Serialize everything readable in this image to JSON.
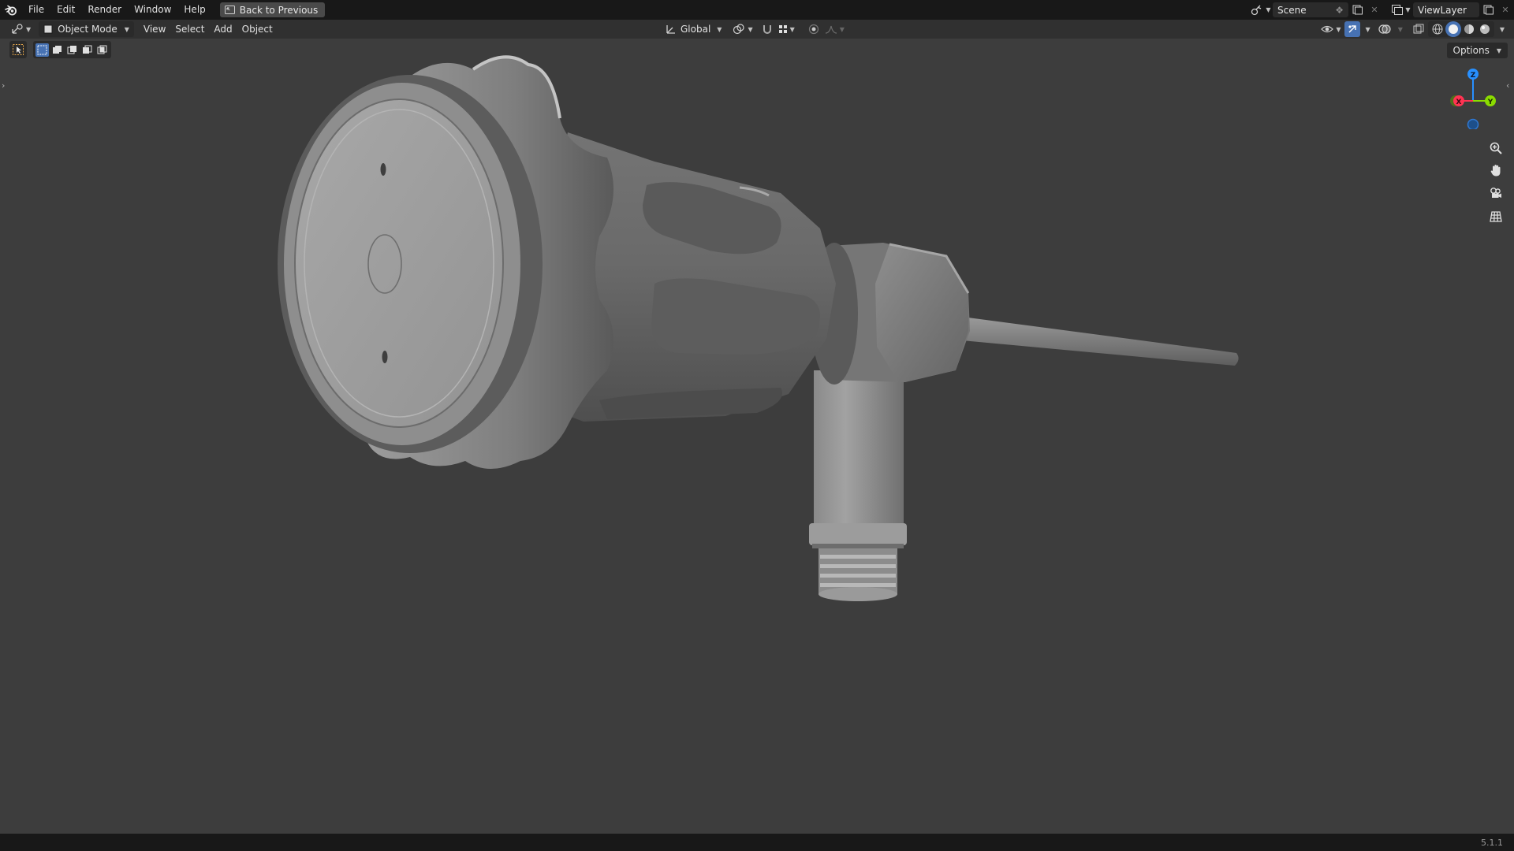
{
  "app": {
    "menus": [
      {
        "label": "File"
      },
      {
        "label": "Edit"
      },
      {
        "label": "Render"
      },
      {
        "label": "Window"
      },
      {
        "label": "Help"
      }
    ],
    "back_button": "Back to Previous",
    "scene_name": "Scene",
    "view_layer": "ViewLayer"
  },
  "viewport_header": {
    "mode": "Object Mode",
    "menus": [
      {
        "label": "View"
      },
      {
        "label": "Select"
      },
      {
        "label": "Add"
      },
      {
        "label": "Object"
      }
    ],
    "transform_orientation": "Global",
    "options_label": "Options"
  },
  "gizmo": {
    "z_label": "Z",
    "y_label": "Y",
    "x_label": "X",
    "colors": {
      "x": "#ff3352",
      "y": "#8bdc00",
      "z": "#2890ff"
    }
  },
  "nav_icons": [
    "zoom-icon",
    "hand-icon",
    "camera-icon",
    "grid-icon"
  ],
  "status": {
    "version": "5.1.1"
  },
  "theme": {
    "accent": "#4772b3",
    "viewport_bg": "#3d3d3d",
    "header_bg": "#303030",
    "topbar_bg": "#181818"
  }
}
